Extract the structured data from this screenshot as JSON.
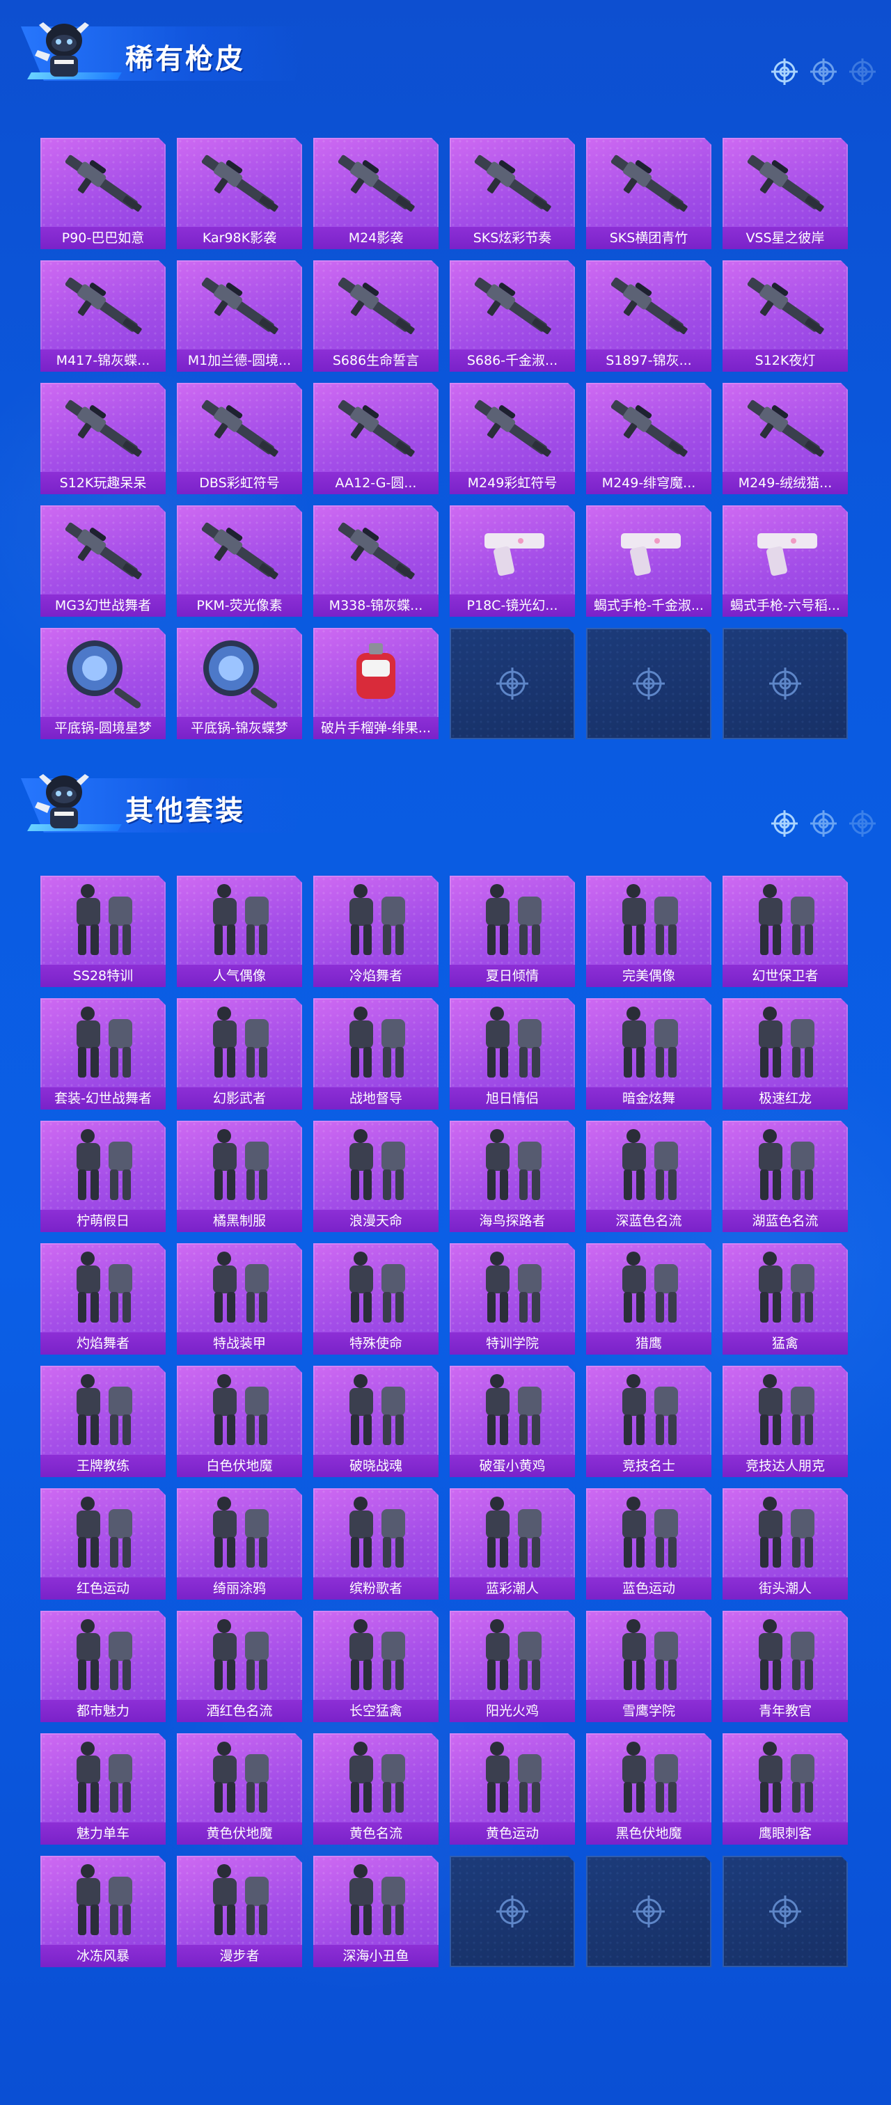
{
  "sections": [
    {
      "title": "稀有枪皮",
      "items": [
        {
          "label": "P90-巴巴如意",
          "icon": "gun-skin-icon"
        },
        {
          "label": "Kar98K影袭",
          "icon": "gun-skin-icon"
        },
        {
          "label": "M24影袭",
          "icon": "gun-skin-icon"
        },
        {
          "label": "SKS炫彩节奏",
          "icon": "gun-skin-icon"
        },
        {
          "label": "SKS横团青竹",
          "icon": "gun-skin-icon"
        },
        {
          "label": "VSS星之彼岸",
          "icon": "gun-skin-icon"
        },
        {
          "label": "M417-锦灰蝶...",
          "icon": "gun-skin-icon"
        },
        {
          "label": "M1加兰德-圆境...",
          "icon": "gun-skin-icon"
        },
        {
          "label": "S686生命誓言",
          "icon": "gun-skin-icon"
        },
        {
          "label": "S686-千金淑...",
          "icon": "gun-skin-icon"
        },
        {
          "label": "S1897-锦灰...",
          "icon": "gun-skin-icon"
        },
        {
          "label": "S12K夜灯",
          "icon": "gun-skin-icon"
        },
        {
          "label": "S12K玩趣呆呆",
          "icon": "gun-skin-icon"
        },
        {
          "label": "DBS彩虹符号",
          "icon": "gun-skin-icon"
        },
        {
          "label": "AA12-G-圆...",
          "icon": "gun-skin-icon"
        },
        {
          "label": "M249彩虹符号",
          "icon": "gun-skin-icon"
        },
        {
          "label": "M249-绯穹魔...",
          "icon": "gun-skin-icon"
        },
        {
          "label": "M249-绒绒猫...",
          "icon": "gun-skin-icon"
        },
        {
          "label": "MG3幻世战舞者",
          "icon": "gun-skin-icon"
        },
        {
          "label": "PKM-荧光像素",
          "icon": "gun-skin-icon"
        },
        {
          "label": "M338-锦灰蝶...",
          "icon": "gun-skin-icon"
        },
        {
          "label": "P18C-镜光幻...",
          "icon": "pistol-skin-icon"
        },
        {
          "label": "蝎式手枪-千金淑...",
          "icon": "pistol-skin-icon"
        },
        {
          "label": "蝎式手枪-六号稻...",
          "icon": "pistol-skin-icon"
        },
        {
          "label": "平底锅-圆境星梦",
          "icon": "pan-skin-icon"
        },
        {
          "label": "平底锅-锦灰蝶梦",
          "icon": "pan-skin-icon"
        },
        {
          "label": "破片手榴弹-绯果...",
          "icon": "grenade-skin-icon"
        }
      ],
      "empty_slots": 3
    },
    {
      "title": "其他套装",
      "items": [
        {
          "label": "SS28特训",
          "icon": "outfit-icon"
        },
        {
          "label": "人气偶像",
          "icon": "outfit-icon"
        },
        {
          "label": "冷焰舞者",
          "icon": "outfit-icon"
        },
        {
          "label": "夏日倾情",
          "icon": "outfit-icon"
        },
        {
          "label": "完美偶像",
          "icon": "outfit-icon"
        },
        {
          "label": "幻世保卫者",
          "icon": "outfit-icon"
        },
        {
          "label": "套装-幻世战舞者",
          "icon": "outfit-icon"
        },
        {
          "label": "幻影武者",
          "icon": "outfit-icon"
        },
        {
          "label": "战地督导",
          "icon": "outfit-icon"
        },
        {
          "label": "旭日情侣",
          "icon": "outfit-icon"
        },
        {
          "label": "暗金炫舞",
          "icon": "outfit-icon"
        },
        {
          "label": "极速红龙",
          "icon": "outfit-icon"
        },
        {
          "label": "柠萌假日",
          "icon": "outfit-icon"
        },
        {
          "label": "橘黑制服",
          "icon": "outfit-icon"
        },
        {
          "label": "浪漫天命",
          "icon": "outfit-icon"
        },
        {
          "label": "海鸟探路者",
          "icon": "outfit-icon"
        },
        {
          "label": "深蓝色名流",
          "icon": "outfit-icon"
        },
        {
          "label": "湖蓝色名流",
          "icon": "outfit-icon"
        },
        {
          "label": "灼焰舞者",
          "icon": "outfit-icon"
        },
        {
          "label": "特战装甲",
          "icon": "outfit-icon"
        },
        {
          "label": "特殊使命",
          "icon": "outfit-icon"
        },
        {
          "label": "特训学院",
          "icon": "outfit-icon"
        },
        {
          "label": "猎鹰",
          "icon": "outfit-icon"
        },
        {
          "label": "猛禽",
          "icon": "outfit-icon"
        },
        {
          "label": "王牌教练",
          "icon": "outfit-icon"
        },
        {
          "label": "白色伏地魔",
          "icon": "outfit-icon"
        },
        {
          "label": "破晓战魂",
          "icon": "outfit-icon"
        },
        {
          "label": "破蛋小黄鸡",
          "icon": "outfit-icon"
        },
        {
          "label": "竞技名士",
          "icon": "outfit-icon"
        },
        {
          "label": "竞技达人朋克",
          "icon": "outfit-icon"
        },
        {
          "label": "红色运动",
          "icon": "outfit-icon"
        },
        {
          "label": "绮丽涂鸦",
          "icon": "outfit-icon"
        },
        {
          "label": "缤粉歌者",
          "icon": "outfit-icon"
        },
        {
          "label": "蓝彩潮人",
          "icon": "outfit-icon"
        },
        {
          "label": "蓝色运动",
          "icon": "outfit-icon"
        },
        {
          "label": "街头潮人",
          "icon": "outfit-icon"
        },
        {
          "label": "都市魅力",
          "icon": "outfit-icon"
        },
        {
          "label": "酒红色名流",
          "icon": "outfit-icon"
        },
        {
          "label": "长空猛禽",
          "icon": "outfit-icon"
        },
        {
          "label": "阳光火鸡",
          "icon": "outfit-icon"
        },
        {
          "label": "雪鹰学院",
          "icon": "outfit-icon"
        },
        {
          "label": "青年教官",
          "icon": "outfit-icon"
        },
        {
          "label": "魅力单车",
          "icon": "outfit-icon"
        },
        {
          "label": "黄色伏地魔",
          "icon": "outfit-icon"
        },
        {
          "label": "黄色名流",
          "icon": "outfit-icon"
        },
        {
          "label": "黄色运动",
          "icon": "outfit-icon"
        },
        {
          "label": "黑色伏地魔",
          "icon": "outfit-icon"
        },
        {
          "label": "鹰眼刺客",
          "icon": "outfit-icon"
        },
        {
          "label": "冰冻风暴",
          "icon": "outfit-icon"
        },
        {
          "label": "漫步者",
          "icon": "outfit-icon"
        },
        {
          "label": "深海小丑鱼",
          "icon": "outfit-icon"
        }
      ],
      "empty_slots": 3
    }
  ],
  "colors": {
    "background": "#0b5ae0",
    "card_purple": "#a44ee8",
    "label_purple": "#7a22c9",
    "empty_slot": "#1c3b7a"
  }
}
